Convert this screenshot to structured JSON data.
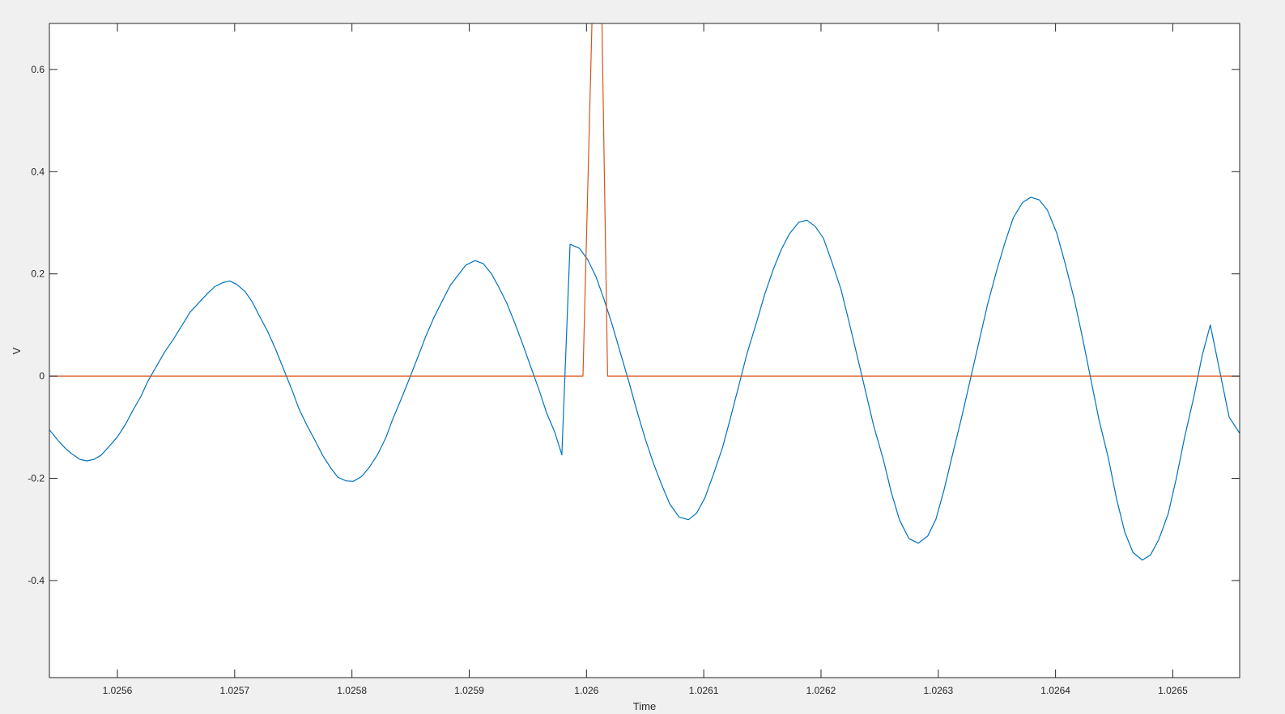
{
  "chart_data": {
    "type": "line",
    "title": "",
    "xlabel": "Time",
    "ylabel": "V",
    "xlim": [
      1.025542,
      1.026557
    ],
    "ylim": [
      -0.59,
      0.69
    ],
    "grid": false,
    "x_ticks": [
      1.0256,
      1.0257,
      1.0258,
      1.0259,
      1.026,
      1.0261,
      1.0262,
      1.0263,
      1.0264,
      1.0265
    ],
    "x_tick_labels": [
      "1.0256",
      "1.0257",
      "1.0258",
      "1.0259",
      "1.026",
      "1.0261",
      "1.0262",
      "1.0263",
      "1.0264",
      "1.0265"
    ],
    "y_ticks": [
      -0.4,
      -0.2,
      0,
      0.2,
      0.4,
      0.6
    ],
    "y_tick_labels": [
      "-0.4",
      "-0.2",
      "0",
      "0.2",
      "0.4",
      "0.6"
    ],
    "series": [
      {
        "color": "#0072bd",
        "points": [
          [
            1.025542,
            -0.105
          ],
          [
            1.025549,
            -0.125
          ],
          [
            1.025555,
            -0.14
          ],
          [
            1.025561,
            -0.152
          ],
          [
            1.025568,
            -0.163
          ],
          [
            1.025574,
            -0.166
          ],
          [
            1.02558,
            -0.163
          ],
          [
            1.025586,
            -0.155
          ],
          [
            1.025592,
            -0.14
          ],
          [
            1.0256,
            -0.119
          ],
          [
            1.025607,
            -0.094
          ],
          [
            1.025613,
            -0.068
          ],
          [
            1.02562,
            -0.04
          ],
          [
            1.025626,
            -0.01
          ],
          [
            1.025633,
            0.018
          ],
          [
            1.02564,
            0.046
          ],
          [
            1.025648,
            0.073
          ],
          [
            1.025655,
            0.099
          ],
          [
            1.025662,
            0.125
          ],
          [
            1.02567,
            0.145
          ],
          [
            1.025677,
            0.162
          ],
          [
            1.025683,
            0.175
          ],
          [
            1.02569,
            0.183
          ],
          [
            1.025696,
            0.186
          ],
          [
            1.025702,
            0.179
          ],
          [
            1.025709,
            0.165
          ],
          [
            1.025715,
            0.145
          ],
          [
            1.025721,
            0.118
          ],
          [
            1.025728,
            0.088
          ],
          [
            1.025735,
            0.052
          ],
          [
            1.025742,
            0.012
          ],
          [
            1.025749,
            -0.028
          ],
          [
            1.025755,
            -0.065
          ],
          [
            1.025762,
            -0.098
          ],
          [
            1.025769,
            -0.128
          ],
          [
            1.025775,
            -0.155
          ],
          [
            1.025782,
            -0.18
          ],
          [
            1.025788,
            -0.198
          ],
          [
            1.025795,
            -0.205
          ],
          [
            1.025801,
            -0.206
          ],
          [
            1.025808,
            -0.197
          ],
          [
            1.025815,
            -0.178
          ],
          [
            1.025822,
            -0.153
          ],
          [
            1.025829,
            -0.12
          ],
          [
            1.025835,
            -0.083
          ],
          [
            1.025842,
            -0.045
          ],
          [
            1.025849,
            -0.005
          ],
          [
            1.025856,
            0.036
          ],
          [
            1.025863,
            0.078
          ],
          [
            1.02587,
            0.115
          ],
          [
            1.025877,
            0.147
          ],
          [
            1.025884,
            0.178
          ],
          [
            1.02589,
            0.196
          ],
          [
            1.025897,
            0.217
          ],
          [
            1.025905,
            0.226
          ],
          [
            1.025912,
            0.22
          ],
          [
            1.025919,
            0.2
          ],
          [
            1.025925,
            0.175
          ],
          [
            1.025932,
            0.143
          ],
          [
            1.025939,
            0.103
          ],
          [
            1.025946,
            0.06
          ],
          [
            1.025953,
            0.015
          ],
          [
            1.02596,
            -0.03
          ],
          [
            1.025966,
            -0.072
          ],
          [
            1.025973,
            -0.11
          ],
          [
            1.025979,
            -0.154
          ],
          [
            1.025986,
            0.258
          ],
          [
            1.025994,
            0.25
          ],
          [
            1.026001,
            0.228
          ],
          [
            1.026008,
            0.195
          ],
          [
            1.026015,
            0.15
          ],
          [
            1.026022,
            0.1
          ],
          [
            1.026029,
            0.045
          ],
          [
            1.026036,
            -0.01
          ],
          [
            1.026043,
            -0.068
          ],
          [
            1.02605,
            -0.122
          ],
          [
            1.026057,
            -0.17
          ],
          [
            1.026064,
            -0.212
          ],
          [
            1.026071,
            -0.25
          ],
          [
            1.026079,
            -0.276
          ],
          [
            1.026087,
            -0.281
          ],
          [
            1.026094,
            -0.268
          ],
          [
            1.026101,
            -0.238
          ],
          [
            1.026108,
            -0.194
          ],
          [
            1.026116,
            -0.14
          ],
          [
            1.026123,
            -0.08
          ],
          [
            1.02613,
            -0.018
          ],
          [
            1.026137,
            0.045
          ],
          [
            1.026145,
            0.105
          ],
          [
            1.026152,
            0.16
          ],
          [
            1.026159,
            0.207
          ],
          [
            1.026166,
            0.247
          ],
          [
            1.026173,
            0.278
          ],
          [
            1.026181,
            0.301
          ],
          [
            1.026188,
            0.305
          ],
          [
            1.026195,
            0.293
          ],
          [
            1.026202,
            0.27
          ],
          [
            1.026209,
            0.225
          ],
          [
            1.026217,
            0.17
          ],
          [
            1.026224,
            0.105
          ],
          [
            1.026231,
            0.038
          ],
          [
            1.026238,
            -0.03
          ],
          [
            1.026245,
            -0.098
          ],
          [
            1.026253,
            -0.162
          ],
          [
            1.02626,
            -0.228
          ],
          [
            1.026267,
            -0.282
          ],
          [
            1.026275,
            -0.318
          ],
          [
            1.026283,
            -0.327
          ],
          [
            1.026291,
            -0.313
          ],
          [
            1.026298,
            -0.28
          ],
          [
            1.026305,
            -0.222
          ],
          [
            1.026312,
            -0.155
          ],
          [
            1.02632,
            -0.08
          ],
          [
            1.026328,
            0.0
          ],
          [
            1.026335,
            0.07
          ],
          [
            1.026342,
            0.14
          ],
          [
            1.02635,
            0.208
          ],
          [
            1.026357,
            0.262
          ],
          [
            1.026364,
            0.31
          ],
          [
            1.026372,
            0.34
          ],
          [
            1.026379,
            0.35
          ],
          [
            1.026386,
            0.345
          ],
          [
            1.026393,
            0.325
          ],
          [
            1.026401,
            0.28
          ],
          [
            1.026408,
            0.222
          ],
          [
            1.026416,
            0.15
          ],
          [
            1.026423,
            0.075
          ],
          [
            1.02643,
            -0.005
          ],
          [
            1.026437,
            -0.085
          ],
          [
            1.026445,
            -0.16
          ],
          [
            1.026452,
            -0.24
          ],
          [
            1.026459,
            -0.305
          ],
          [
            1.026466,
            -0.345
          ],
          [
            1.026474,
            -0.36
          ],
          [
            1.026481,
            -0.35
          ],
          [
            1.026488,
            -0.32
          ],
          [
            1.026496,
            -0.27
          ],
          [
            1.026503,
            -0.2
          ],
          [
            1.02651,
            -0.12
          ],
          [
            1.026518,
            -0.04
          ],
          [
            1.026525,
            0.04
          ],
          [
            1.026532,
            0.1
          ],
          [
            1.02654,
            0.01
          ],
          [
            1.026548,
            -0.08
          ],
          [
            1.026557,
            -0.112
          ]
        ]
      },
      {
        "color": "#d95319",
        "points": [
          [
            1.025542,
            0.0
          ],
          [
            1.025997,
            0.0
          ],
          [
            1.026005,
            0.72
          ],
          [
            1.026013,
            0.72
          ],
          [
            1.026018,
            0.0
          ],
          [
            1.026557,
            0.0
          ]
        ]
      }
    ]
  }
}
